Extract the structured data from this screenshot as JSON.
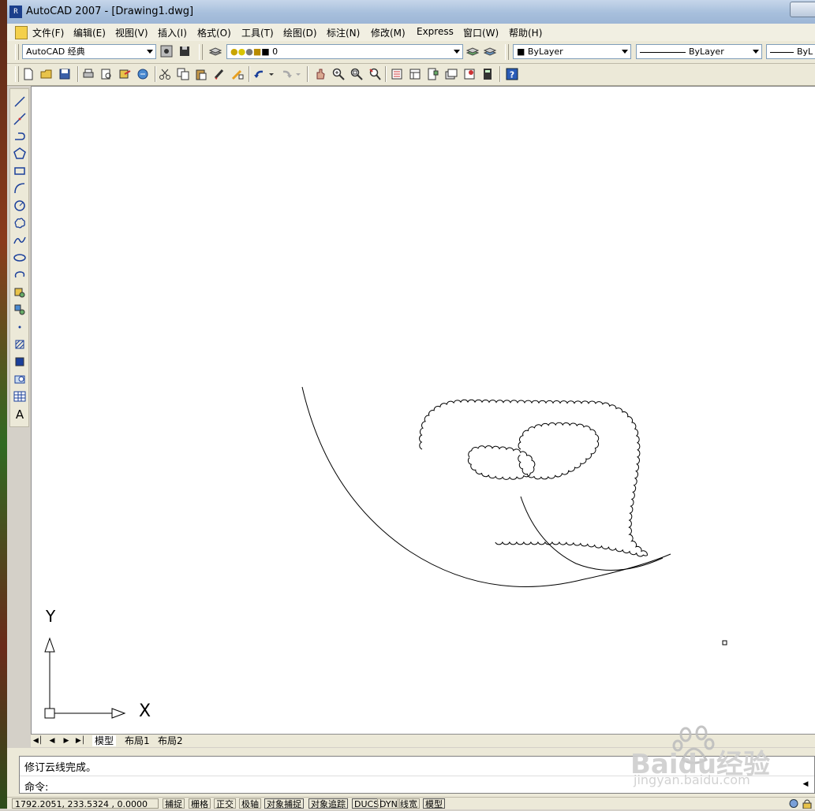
{
  "window": {
    "title": "AutoCAD 2007 - [Drawing1.dwg]",
    "app_icon_text": "R"
  },
  "menu": [
    "文件(F)",
    "编辑(E)",
    "视图(V)",
    "插入(I)",
    "格式(O)",
    "工具(T)",
    "绘图(D)",
    "标注(N)",
    "修改(M)",
    "Express",
    "窗口(W)",
    "帮助(H)"
  ],
  "toolbar": {
    "workspace": "AutoCAD 经典",
    "layer": "0",
    "color": "ByLayer",
    "linetype": "ByLayer",
    "lineweight": "ByL"
  },
  "ucs": {
    "y_label": "Y",
    "x_label": "X"
  },
  "layout_tabs": [
    "模型",
    "布局1",
    "布局2"
  ],
  "command": {
    "history": "修订云线完成。",
    "prompt": "命令:"
  },
  "status": {
    "coords": "1792.2051, 233.5324 , 0.0000",
    "toggles": [
      "捕捉",
      "栅格",
      "正交",
      "极轴",
      "对象捕捉",
      "对象追踪",
      "DUCS",
      "DYN",
      "线宽",
      "模型"
    ]
  },
  "watermark": {
    "brand": "Baidu经验",
    "url": "jingyan.baidu.com"
  },
  "colors": {
    "canvas": "#ffffff",
    "chrome": "#ece9d8",
    "title_bar": "#a7bfdc"
  }
}
